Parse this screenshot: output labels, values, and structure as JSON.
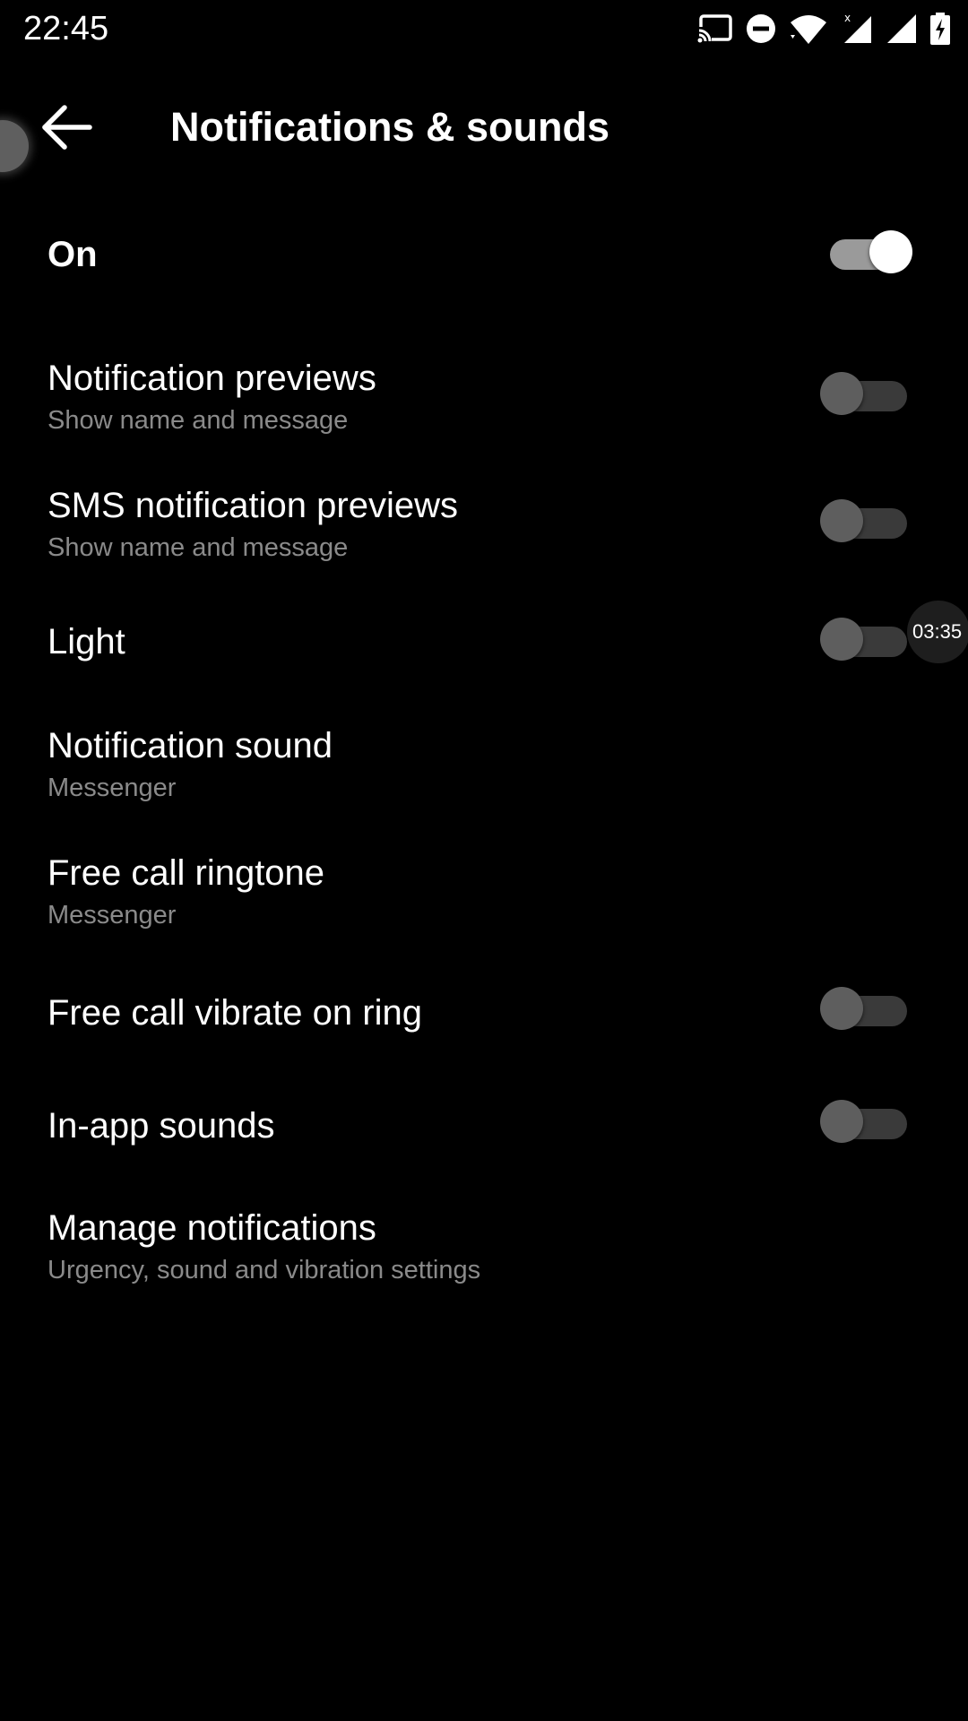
{
  "status_bar": {
    "time": "22:45",
    "icons": [
      "cast-icon",
      "do-not-disturb-icon",
      "wifi-icon",
      "signal-icon",
      "signal-icon",
      "battery-charging-icon"
    ]
  },
  "app_bar": {
    "title": "Notifications & sounds",
    "back_icon": "arrow-left-icon"
  },
  "settings": {
    "on": {
      "title": "On",
      "enabled": true
    },
    "notification_previews": {
      "title": "Notification previews",
      "subtitle": "Show name and message",
      "enabled": false
    },
    "sms_notification_previews": {
      "title": "SMS notification previews",
      "subtitle": "Show name and message",
      "enabled": false
    },
    "light": {
      "title": "Light",
      "enabled": false
    },
    "notification_sound": {
      "title": "Notification sound",
      "subtitle": "Messenger"
    },
    "free_call_ringtone": {
      "title": "Free call ringtone",
      "subtitle": "Messenger"
    },
    "free_call_vibrate": {
      "title": "Free call vibrate on ring",
      "enabled": false
    },
    "in_app_sounds": {
      "title": "In-app sounds",
      "enabled": false
    },
    "manage_notifications": {
      "title": "Manage notifications",
      "subtitle": "Urgency, sound and vibration settings"
    }
  },
  "overlay": {
    "timer": "03:35"
  }
}
